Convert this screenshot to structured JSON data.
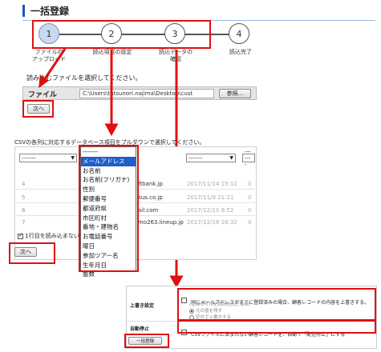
{
  "page": {
    "title": "一括登録"
  },
  "steps": [
    {
      "number": "1",
      "label": "ファイルの\nアップロード"
    },
    {
      "number": "2",
      "label": "読込項目の設定"
    },
    {
      "number": "3",
      "label": "読込データの\n確認"
    },
    {
      "number": "4",
      "label": "読込完了"
    }
  ],
  "upload": {
    "instruction": "読み込むファイルを選択してください。",
    "file_label": "ファイル",
    "file_path": "C:\\Users\\tatsunori.najima\\Desktop\\cust",
    "browse_label": "参照...",
    "next_label": "次へ"
  },
  "mapping": {
    "caption": "CSVの各列に対応するデータベース項目をプルダウンで選択してください。",
    "select_default": "-------",
    "rows": [
      {
        "num": "4",
        "value": "ftbank.jp",
        "date": "2017/11/14 15:12",
        "tail": "0"
      },
      {
        "num": "5",
        "value": "kus.co.jp",
        "date": "2017/11/9 21:21",
        "tail": "0"
      },
      {
        "num": "6",
        "value": "ail.com",
        "date": "2017/12/10 8:52",
        "tail": "0"
      },
      {
        "num": "7",
        "value": "mo263.lineup.jp",
        "date": "2017/12/18 16:32",
        "tail": "0"
      }
    ],
    "skip_first_row_label": "1行目を読み込まない",
    "next_label": "次へ",
    "dropdown_options": [
      "-------",
      "メールアドレス",
      "お名前",
      "お名前(フリガナ)",
      "性別",
      "郵便番号",
      "都道府県",
      "市区町村",
      "番地・建物名",
      "お電話番号",
      "曜日",
      "参加ツアー名",
      "生年月日",
      "整数"
    ],
    "dropdown_selected": "メールアドレス"
  },
  "settings": {
    "overwrite_label": "上書き設定",
    "overwrite_text": "同じメールアドレスがすでに登録済みの場合、顧客レコードの内容を上書きする。",
    "overwrite_sub": "(空白のセルを読み込んだ場合)",
    "radio_keep": "元の値を残す",
    "radio_blank": "空白で上書きする",
    "auto_stop_label": "自動停止",
    "auto_stop_text": "CSVファイルに含まれない顧客レコードを、自動で「配信停止」にする",
    "submit_label": "一括登録"
  },
  "colors": {
    "highlight": "#e01010",
    "title_accent": "#1a57b5",
    "dropdown_selection": "#1e5fc9"
  }
}
